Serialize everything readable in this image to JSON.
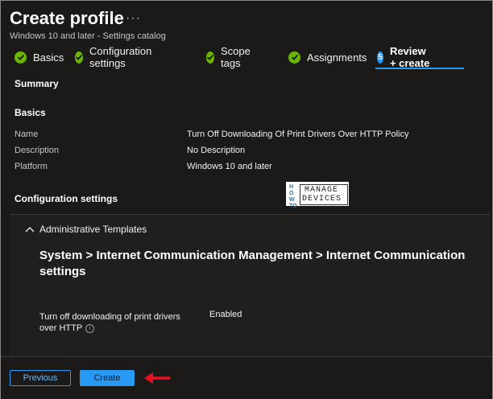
{
  "header": {
    "title": "Create profile",
    "more_label": "···",
    "subtitle": "Windows 10 and later - Settings catalog"
  },
  "wizard": {
    "steps": [
      {
        "label": "Basics",
        "state": "complete"
      },
      {
        "label": "Configuration settings",
        "state": "complete"
      },
      {
        "label": "Scope tags",
        "state": "complete"
      },
      {
        "label": "Assignments",
        "state": "complete"
      },
      {
        "label": "Review + create",
        "number": "5",
        "state": "active"
      }
    ]
  },
  "summary": {
    "heading": "Summary",
    "basics_heading": "Basics",
    "fields": [
      {
        "label": "Name",
        "value": "Turn Off Downloading Of Print Drivers Over HTTP Policy"
      },
      {
        "label": "Description",
        "value": "No Description"
      },
      {
        "label": "Platform",
        "value": "Windows 10 and later"
      }
    ],
    "config_heading": "Configuration settings"
  },
  "watermark": {
    "how_to": "HOW TO",
    "manage": "MANAGE",
    "devices": "DEVICES"
  },
  "config": {
    "group_label": "Administrative Templates",
    "path": "System > Internet Communication Management > Internet Communication settings",
    "setting_label": "Turn off downloading of print drivers over HTTP",
    "info_glyph": "i",
    "setting_value": "Enabled"
  },
  "footer": {
    "previous_label": "Previous",
    "create_label": "Create"
  },
  "colors": {
    "accent": "#2899f5",
    "success": "#6bb700",
    "annotation_arrow": "#e81123",
    "background": "#1b1a19"
  }
}
